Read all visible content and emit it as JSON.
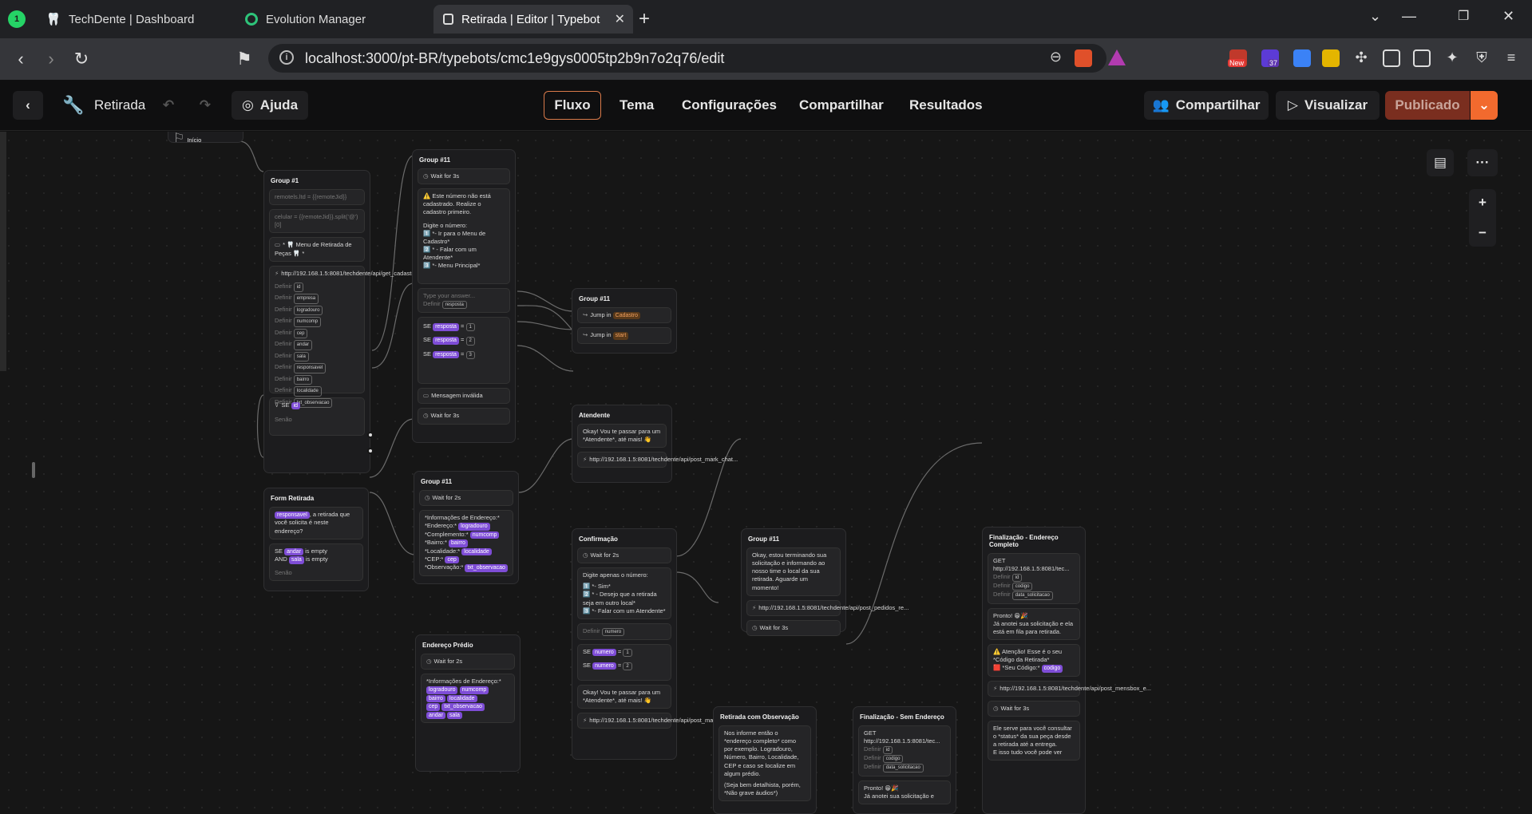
{
  "tabs": [
    {
      "label": "TechDente | Dashboard"
    },
    {
      "label": "Evolution Manager"
    },
    {
      "label": "Retirada | Editor | Typebot"
    }
  ],
  "url": "localhost:3000/pt-BR/typebots/cmc1e9gys0005tp2b9n7o2q76/edit",
  "ext": {
    "new_badge": "New",
    "count_badge": "37"
  },
  "header": {
    "bot_name": "Retirada",
    "help": "Ajuda",
    "nav": [
      "Fluxo",
      "Tema",
      "Configurações",
      "Compartilhar",
      "Resultados"
    ],
    "share": "Compartilhar",
    "preview": "Visualizar",
    "publish": "Publicado"
  },
  "canvas": {
    "start": "Início",
    "group1": {
      "title": "Group #1",
      "b1": "remotels.ltd = {{remoteJid}}",
      "b2": "celular = {{remoteJid}}.split('@')[0]",
      "b3": "* 🦷 Menu de Retirada de Peças 🦷 *",
      "b4": "http://192.168.1.5:8081/techdente/api/get_cadastro.ph...",
      "defs": [
        "id",
        "empresa",
        "logradouro",
        "numcomp",
        "cep",
        "andar",
        "sala",
        "responsavel",
        "bairro",
        "localidade",
        "txt_observacao"
      ],
      "cond": "SE",
      "cond_rest": "Senão"
    },
    "group11a": {
      "title": "Group #11",
      "wait": "Wait for 3s",
      "msg1": "⚠️ Este número não está cadastrado. Realize o cadastro primeiro.",
      "msg2": "Digite o número:",
      "opt1": "1️⃣ *- Ir para o Menu de Cadastro*",
      "opt2": "2️⃣ * - Falar com um Atendente*",
      "opt3": "3️⃣ *- Menu Principal*",
      "input": "Type your answer...",
      "define": "resposta",
      "c1": "1",
      "c2": "2",
      "c3": "3",
      "invalid": "Mensagem inválida",
      "wait2": "Wait for 3s"
    },
    "group11b": {
      "title": "Group #11",
      "j1": "Cadastro",
      "j2": "start",
      "jump": "Jump in"
    },
    "atendente": {
      "title": "Atendente",
      "msg": "Okay! Vou te passar para um *Atendente*, até mais! 👋",
      "url": "http://192.168.1.5:8081/techdente/api/post_mark_chat..."
    },
    "form": {
      "title": "Form Retirada",
      "msg": ", a retirada que você solicita é neste endereço?",
      "tag": "responsavel",
      "c1": "andar",
      "c2": "sala",
      "is_empty": "is empty",
      "else": "Senão"
    },
    "group11c": {
      "title": "Group #11",
      "wait": "Wait for 2s",
      "info": "*Informações de Endereço:*",
      "lines": [
        "*Endereço:*",
        "*Complemento:*",
        "*Bairro:*",
        "*Localidade:*",
        "*CEP:*",
        "*Observação:*"
      ],
      "tags": [
        "logradouro",
        "numcomp",
        "bairro",
        "localidade",
        "cep",
        "txt_observacao"
      ]
    },
    "endereco": {
      "title": "Endereço Prédio",
      "wait": "Wait for 2s",
      "info": "*Informações de Endereço:*",
      "tags": [
        "logradouro",
        "numcomp",
        "bairro",
        "localidade",
        "cep",
        "txt_observacao",
        "andar",
        "sala"
      ]
    },
    "confirm": {
      "title": "Confirmação",
      "wait": "Wait for 2s",
      "msg": "Digite apenas o número:",
      "o1": "1️⃣ *- Sim*",
      "o2": "2️⃣ * - Desejo que a retirada seja em outro local*",
      "o3": "3️⃣ *- Falar com um Atendente*",
      "define": "numero",
      "msg2": "Okay! Vou te passar para um *Atendente*, até mais! 👋",
      "url": "http://192.168.1.5:8081/techdente/api/post_mark_chat..."
    },
    "group11d": {
      "title": "Group #11",
      "msg": "Okay, estou terminando sua solicitação e informando ao nosso time o local da sua retirada. Aguarde um momento!",
      "url": "http://192.168.1.5:8081/techdente/api/post_pedidos_re...",
      "wait": "Wait for 3s"
    },
    "obs": {
      "title": "Retirada com Observação",
      "msg": "Nos informe então o *endereço completo* como por exemplo. Logradouro, Número, Bairro, Localidade, CEP e caso se localize em algum prédio.",
      "msg2": "(Seja bem detalhista, porém, *Não grave áudios*)"
    },
    "semend": {
      "title": "Finalização - Sem Endereço",
      "get": "GET",
      "url": "http://192.168.1.5:8081/tec...",
      "d": [
        "id",
        "codigo",
        "data_solicitacao"
      ],
      "ok": "Pronto! 😁🎉",
      "ok2": "Já anotei sua solicitação e"
    },
    "final": {
      "title": "Finalização - Endereço Completo",
      "get": "GET",
      "url": "http://192.168.1.5:8081/tec...",
      "d": [
        "id",
        "codigo",
        "data_solicitacao"
      ],
      "ok": "Pronto! 😁🎉",
      "ok2": "Já anotei sua solicitação e ela está em fila para retirada.",
      "att": "⚠️ Atenção! Esse é o seu *Código da Retirada*",
      "code": "codigo",
      "code_label": "🟥 *Seu Código:*",
      "url2": "http://192.168.1.5:8081/techdente/api/post_mensbox_e...",
      "wait": "Wait for 3s",
      "last": "Ele serve para você consultar o *status* da sua peça desde a retirada até a entrega.",
      "last2": "E isso tudo você pode ver"
    }
  }
}
